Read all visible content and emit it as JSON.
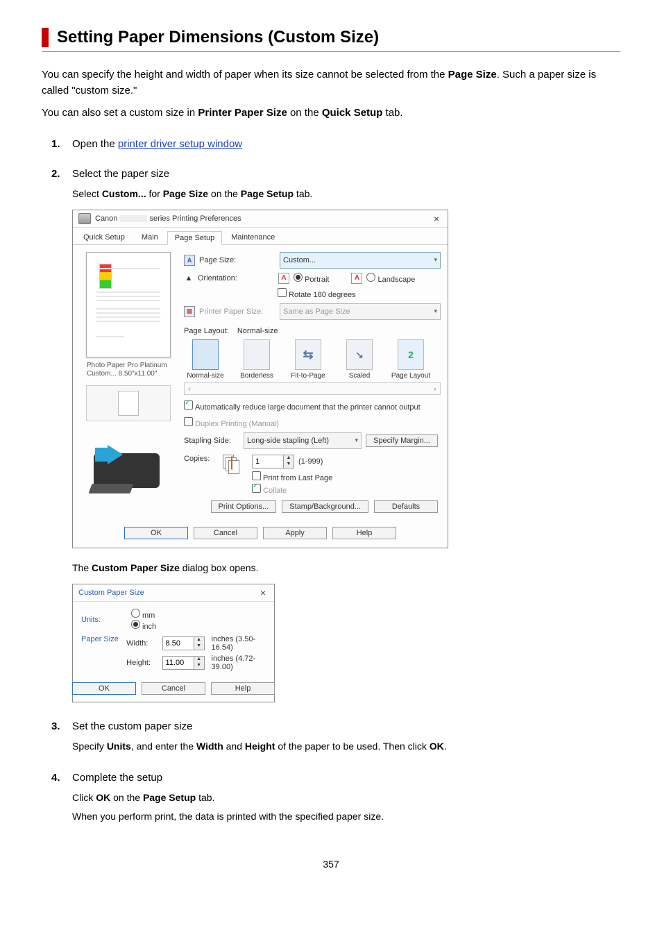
{
  "page": {
    "title": "Setting Paper Dimensions (Custom Size)",
    "intro_parts": [
      "You can specify the height and width of paper when its size cannot be selected from the ",
      "Page Size",
      ". Such a paper size is called \"custom size.\""
    ],
    "intro2_parts": [
      "You can also set a custom size in ",
      "Printer Paper Size",
      " on the ",
      "Quick Setup",
      " tab."
    ],
    "page_number": "357"
  },
  "steps": {
    "s1": {
      "num": "1.",
      "prefix": "Open the ",
      "link": "printer driver setup window"
    },
    "s2": {
      "num": "2.",
      "title": "Select the paper size",
      "instr_parts": [
        "Select ",
        "Custom...",
        " for ",
        "Page Size",
        " on the ",
        "Page Setup",
        " tab."
      ],
      "after_parts": [
        "The ",
        "Custom Paper Size",
        " dialog box opens."
      ]
    },
    "s3": {
      "num": "3.",
      "title": "Set the custom paper size",
      "instr_parts": [
        "Specify ",
        "Units",
        ", and enter the ",
        "Width",
        " and ",
        "Height",
        " of the paper to be used. Then click ",
        "OK",
        "."
      ]
    },
    "s4": {
      "num": "4.",
      "title": "Complete the setup",
      "line1_parts": [
        "Click ",
        "OK",
        " on the ",
        "Page Setup",
        " tab."
      ],
      "line2": "When you perform print, the data is printed with the specified paper size."
    }
  },
  "dialog1": {
    "title_prefix": "Canon",
    "title_suffix": "series Printing Preferences",
    "tabs": [
      "Quick Setup",
      "Main",
      "Page Setup",
      "Maintenance"
    ],
    "active_tab_index": 2,
    "preview_caption_line1": "Photo Paper Pro Platinum",
    "preview_caption_line2": "Custom... 8.50\"x11.00\"",
    "labels": {
      "page_size": "Page Size:",
      "orientation": "Orientation:",
      "portrait": "Portrait",
      "landscape": "Landscape",
      "rotate180": "Rotate 180 degrees",
      "printer_paper_size": "Printer Paper Size:",
      "page_layout": "Page Layout:",
      "page_layout_value": "Normal-size",
      "auto_reduce": "Automatically reduce large document that the printer cannot output",
      "duplex": "Duplex Printing (Manual)",
      "stapling_side": "Stapling Side:",
      "copies": "Copies:",
      "copies_range": "(1-999)",
      "print_last": "Print from Last Page",
      "collate": "Collate"
    },
    "values": {
      "page_size": "Custom...",
      "printer_paper_size": "Same as Page Size",
      "stapling_side": "Long-side stapling (Left)",
      "copies": "1"
    },
    "layouts": [
      "Normal-size",
      "Borderless",
      "Fit-to-Page",
      "Scaled",
      "Page Layout"
    ],
    "layout_badges": [
      "",
      "",
      "⤢",
      "⤡",
      "2"
    ],
    "buttons": {
      "specify_margin": "Specify Margin...",
      "print_options": "Print Options...",
      "stamp_bg": "Stamp/Background...",
      "defaults": "Defaults",
      "ok": "OK",
      "cancel": "Cancel",
      "apply": "Apply",
      "help": "Help"
    }
  },
  "dialog2": {
    "title": "Custom Paper Size",
    "units_label": "Units:",
    "unit_mm": "mm",
    "unit_inch": "inch",
    "paper_size_label": "Paper Size",
    "width_label": "Width:",
    "height_label": "Height:",
    "width_value": "8.50",
    "height_value": "11.00",
    "width_range": "inches (3.50-16.54)",
    "height_range": "inches (4.72-39.00)",
    "ok": "OK",
    "cancel": "Cancel",
    "help": "Help"
  }
}
